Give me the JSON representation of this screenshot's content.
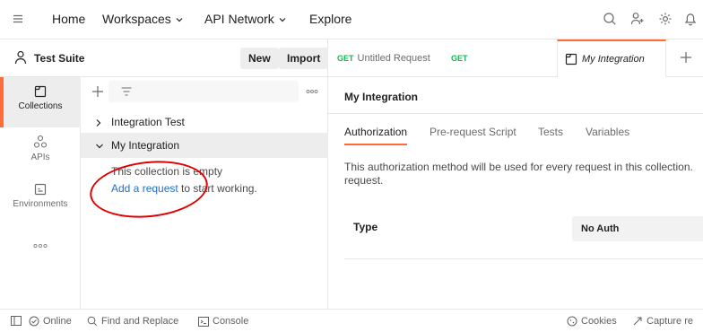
{
  "topbar": {
    "nav": [
      "Home",
      "Workspaces",
      "API Network",
      "Explore"
    ]
  },
  "workspace": {
    "title": "Test Suite",
    "new_label": "New",
    "import_label": "Import"
  },
  "rail": [
    {
      "label": "Collections",
      "icon": "collections-icon",
      "active": true
    },
    {
      "label": "APIs",
      "icon": "apis-icon",
      "active": false
    },
    {
      "label": "Environments",
      "icon": "environments-icon",
      "active": false
    }
  ],
  "collections": {
    "items": [
      {
        "label": "Integration Test",
        "expanded": false
      },
      {
        "label": "My Integration",
        "expanded": true
      }
    ],
    "empty_text": "This collection is empty",
    "add_link": "Add a request",
    "add_suffix": " to start working."
  },
  "tabs": [
    {
      "method": "GET",
      "label": "Untitled Request"
    },
    {
      "method": "GET",
      "label": ""
    },
    {
      "method": "",
      "label": "My Integration",
      "active": true
    }
  ],
  "main": {
    "title": "My Integration",
    "subtabs": [
      "Authorization",
      "Pre-request Script",
      "Tests",
      "Variables"
    ],
    "description": "This authorization method will be used for every request in this collection.",
    "description_line2": "request.",
    "type_label": "Type",
    "type_value": "No Auth"
  },
  "statusbar": {
    "online": "Online",
    "find": "Find and Replace",
    "console": "Console",
    "cookies": "Cookies",
    "capture": "Capture re"
  },
  "colors": {
    "accent": "#ff6c37",
    "link": "#1f6fd1",
    "get_method": "#0cbb52",
    "annotation": "#e00000"
  }
}
